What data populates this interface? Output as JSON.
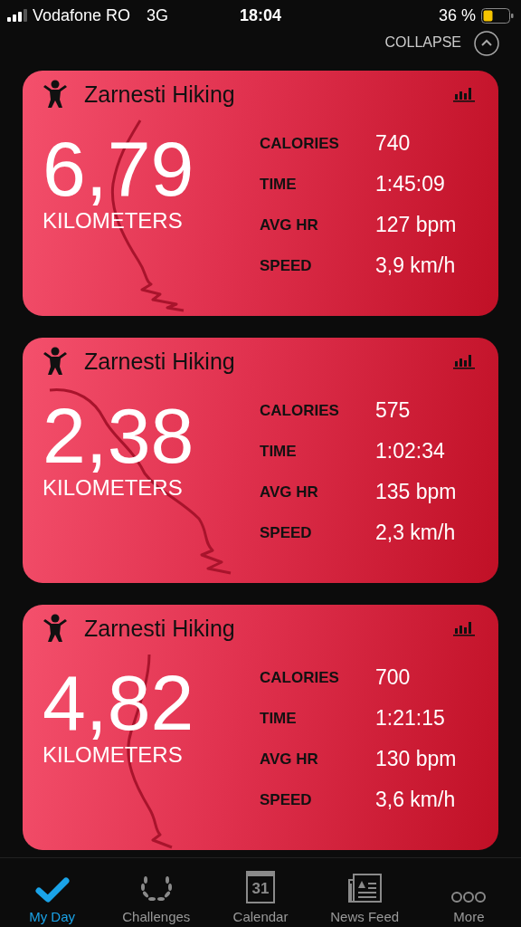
{
  "status_bar": {
    "carrier": "Vodafone RO",
    "network": "3G",
    "time": "18:04",
    "battery": "36 %"
  },
  "collapse": {
    "label": "COLLAPSE"
  },
  "activities": [
    {
      "title": "Zarnesti Hiking",
      "distance": "6,79",
      "unit": "KILOMETERS",
      "stats": [
        {
          "label": "CALORIES",
          "value": "740"
        },
        {
          "label": "TIME",
          "value": "1:45:09"
        },
        {
          "label": "AVG HR",
          "value": "127 bpm"
        },
        {
          "label": "SPEED",
          "value": "3,9 km/h"
        }
      ]
    },
    {
      "title": "Zarnesti Hiking",
      "distance": "2,38",
      "unit": "KILOMETERS",
      "stats": [
        {
          "label": "CALORIES",
          "value": "575"
        },
        {
          "label": "TIME",
          "value": "1:02:34"
        },
        {
          "label": "AVG HR",
          "value": "135 bpm"
        },
        {
          "label": "SPEED",
          "value": "2,3 km/h"
        }
      ]
    },
    {
      "title": "Zarnesti Hiking",
      "distance": "4,82",
      "unit": "KILOMETERS",
      "stats": [
        {
          "label": "CALORIES",
          "value": "700"
        },
        {
          "label": "TIME",
          "value": "1:21:15"
        },
        {
          "label": "AVG HR",
          "value": "130 bpm"
        },
        {
          "label": "SPEED",
          "value": "3,6 km/h"
        }
      ]
    }
  ],
  "tabs": [
    {
      "kind": "check",
      "label": "My Day",
      "selected": true
    },
    {
      "kind": "laurel",
      "label": "Challenges",
      "selected": false
    },
    {
      "kind": "calendar",
      "label": "Calendar",
      "icon_text": "31",
      "selected": false
    },
    {
      "kind": "news",
      "label": "News Feed",
      "selected": false
    },
    {
      "kind": "more",
      "label": "More",
      "selected": false
    }
  ]
}
